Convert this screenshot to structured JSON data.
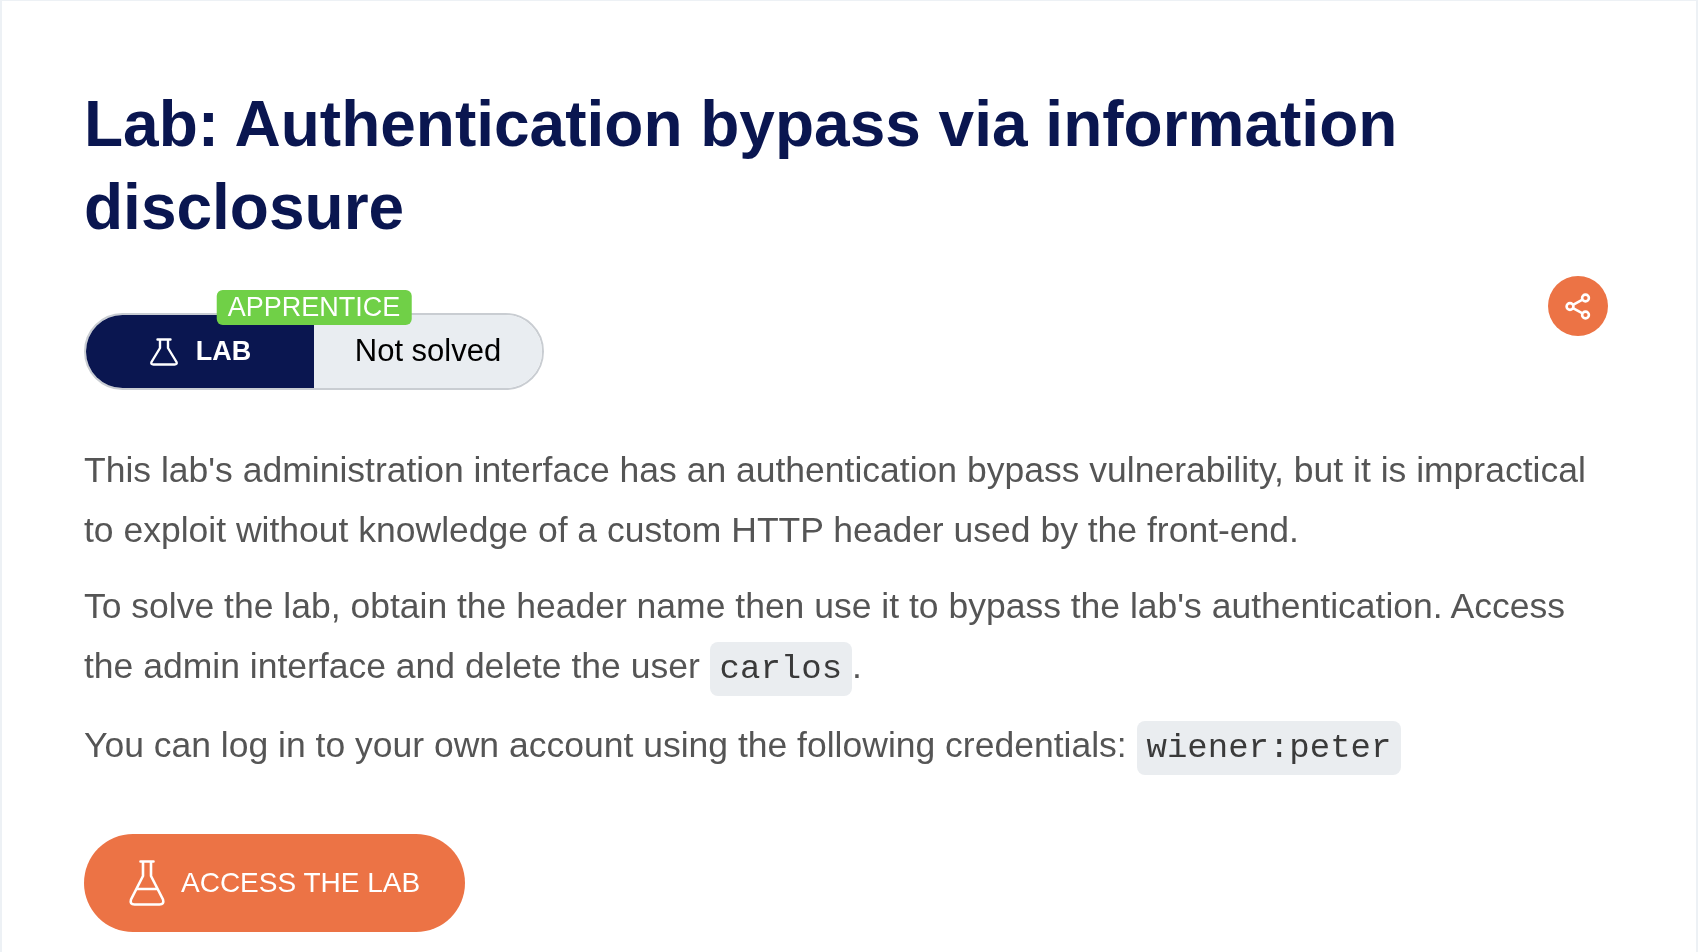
{
  "title": "Lab: Authentication bypass via information disclosure",
  "lab_badge": {
    "difficulty": "APPRENTICE",
    "type": "LAB",
    "status": "Not solved"
  },
  "description": [
    {
      "segments": [
        {
          "kind": "text",
          "text": "This lab's administration interface has an authentication bypass vulnerability, but it is impractical to exploit without knowledge of a custom HTTP header used by the front-end."
        }
      ]
    },
    {
      "segments": [
        {
          "kind": "text",
          "text": "To solve the lab, obtain the header name then use it to bypass the lab's authentication. Access the admin interface and delete the user "
        },
        {
          "kind": "code",
          "text": "carlos"
        },
        {
          "kind": "text",
          "text": "."
        }
      ]
    },
    {
      "segments": [
        {
          "kind": "text",
          "text": "You can log in to your own account using the following credentials: "
        },
        {
          "kind": "code",
          "text": "wiener:peter"
        }
      ]
    }
  ],
  "access_button": {
    "label": "ACCESS THE LAB"
  }
}
